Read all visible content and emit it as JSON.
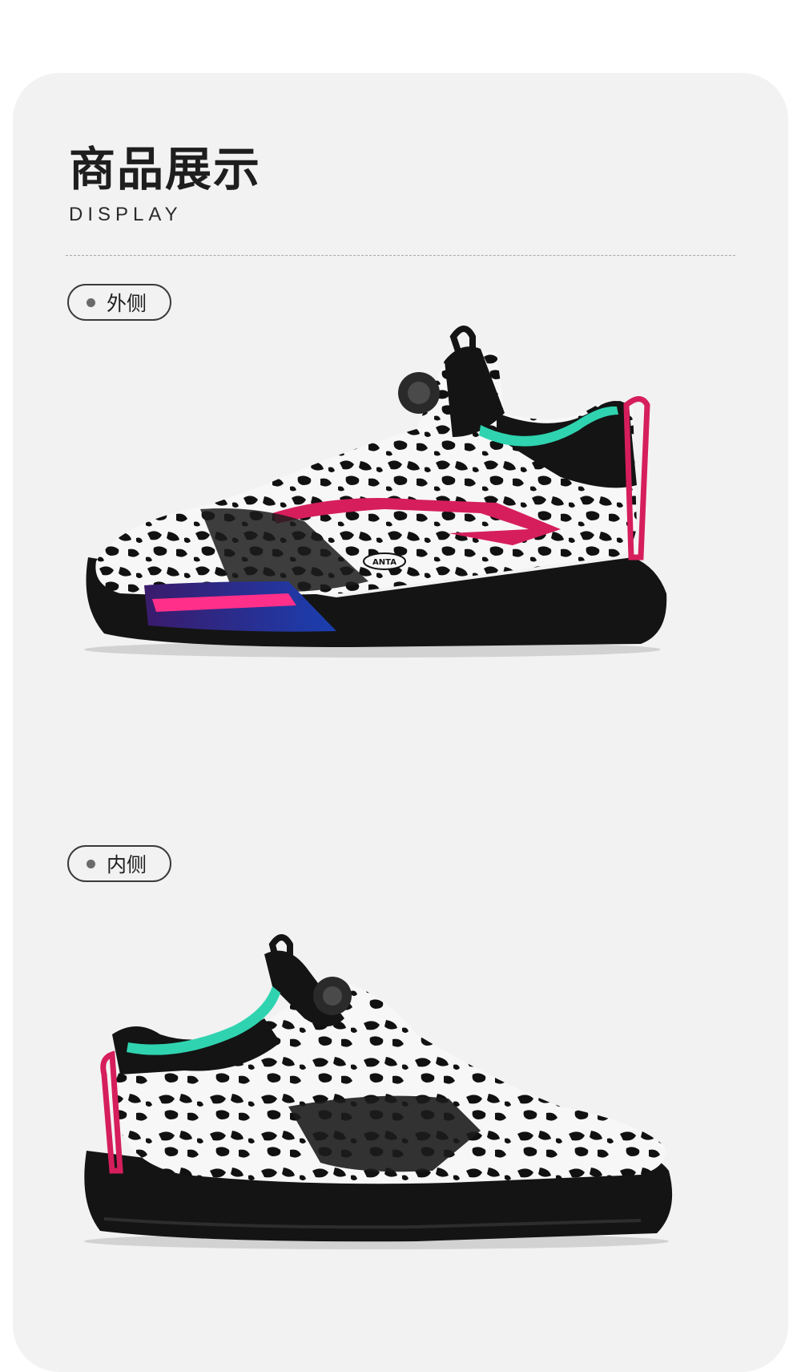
{
  "section": {
    "title": "商品展示",
    "subtitle": "DISPLAY"
  },
  "views": [
    {
      "label": "外侧",
      "image": "basketball-shoe-lateral-view",
      "brand_mark": "ANTA"
    },
    {
      "label": "内侧",
      "image": "basketball-shoe-medial-view"
    }
  ],
  "colors": {
    "background": "#ffffff",
    "card": "#f2f2f2",
    "text": "#1e1e1e",
    "accent_pink": "#d61e5c",
    "accent_teal": "#2fd3b0",
    "shoe_black": "#141414"
  }
}
